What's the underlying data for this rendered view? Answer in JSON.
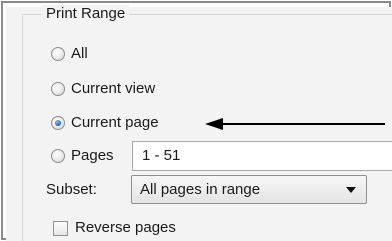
{
  "print_range": {
    "title": "Print Range",
    "options": [
      {
        "label": "All",
        "checked": false
      },
      {
        "label": "Current view",
        "checked": false
      },
      {
        "label": "Current page",
        "checked": true
      },
      {
        "label": "Pages",
        "checked": false
      }
    ],
    "pages_value": "1 - 51",
    "subset_label": "Subset:",
    "subset_value": "All pages in range",
    "reverse_pages_label": "Reverse pages",
    "reverse_pages_checked": false
  },
  "icons": {
    "annotation": "arrow-left-icon",
    "dropdown": "chevron-down-icon"
  }
}
